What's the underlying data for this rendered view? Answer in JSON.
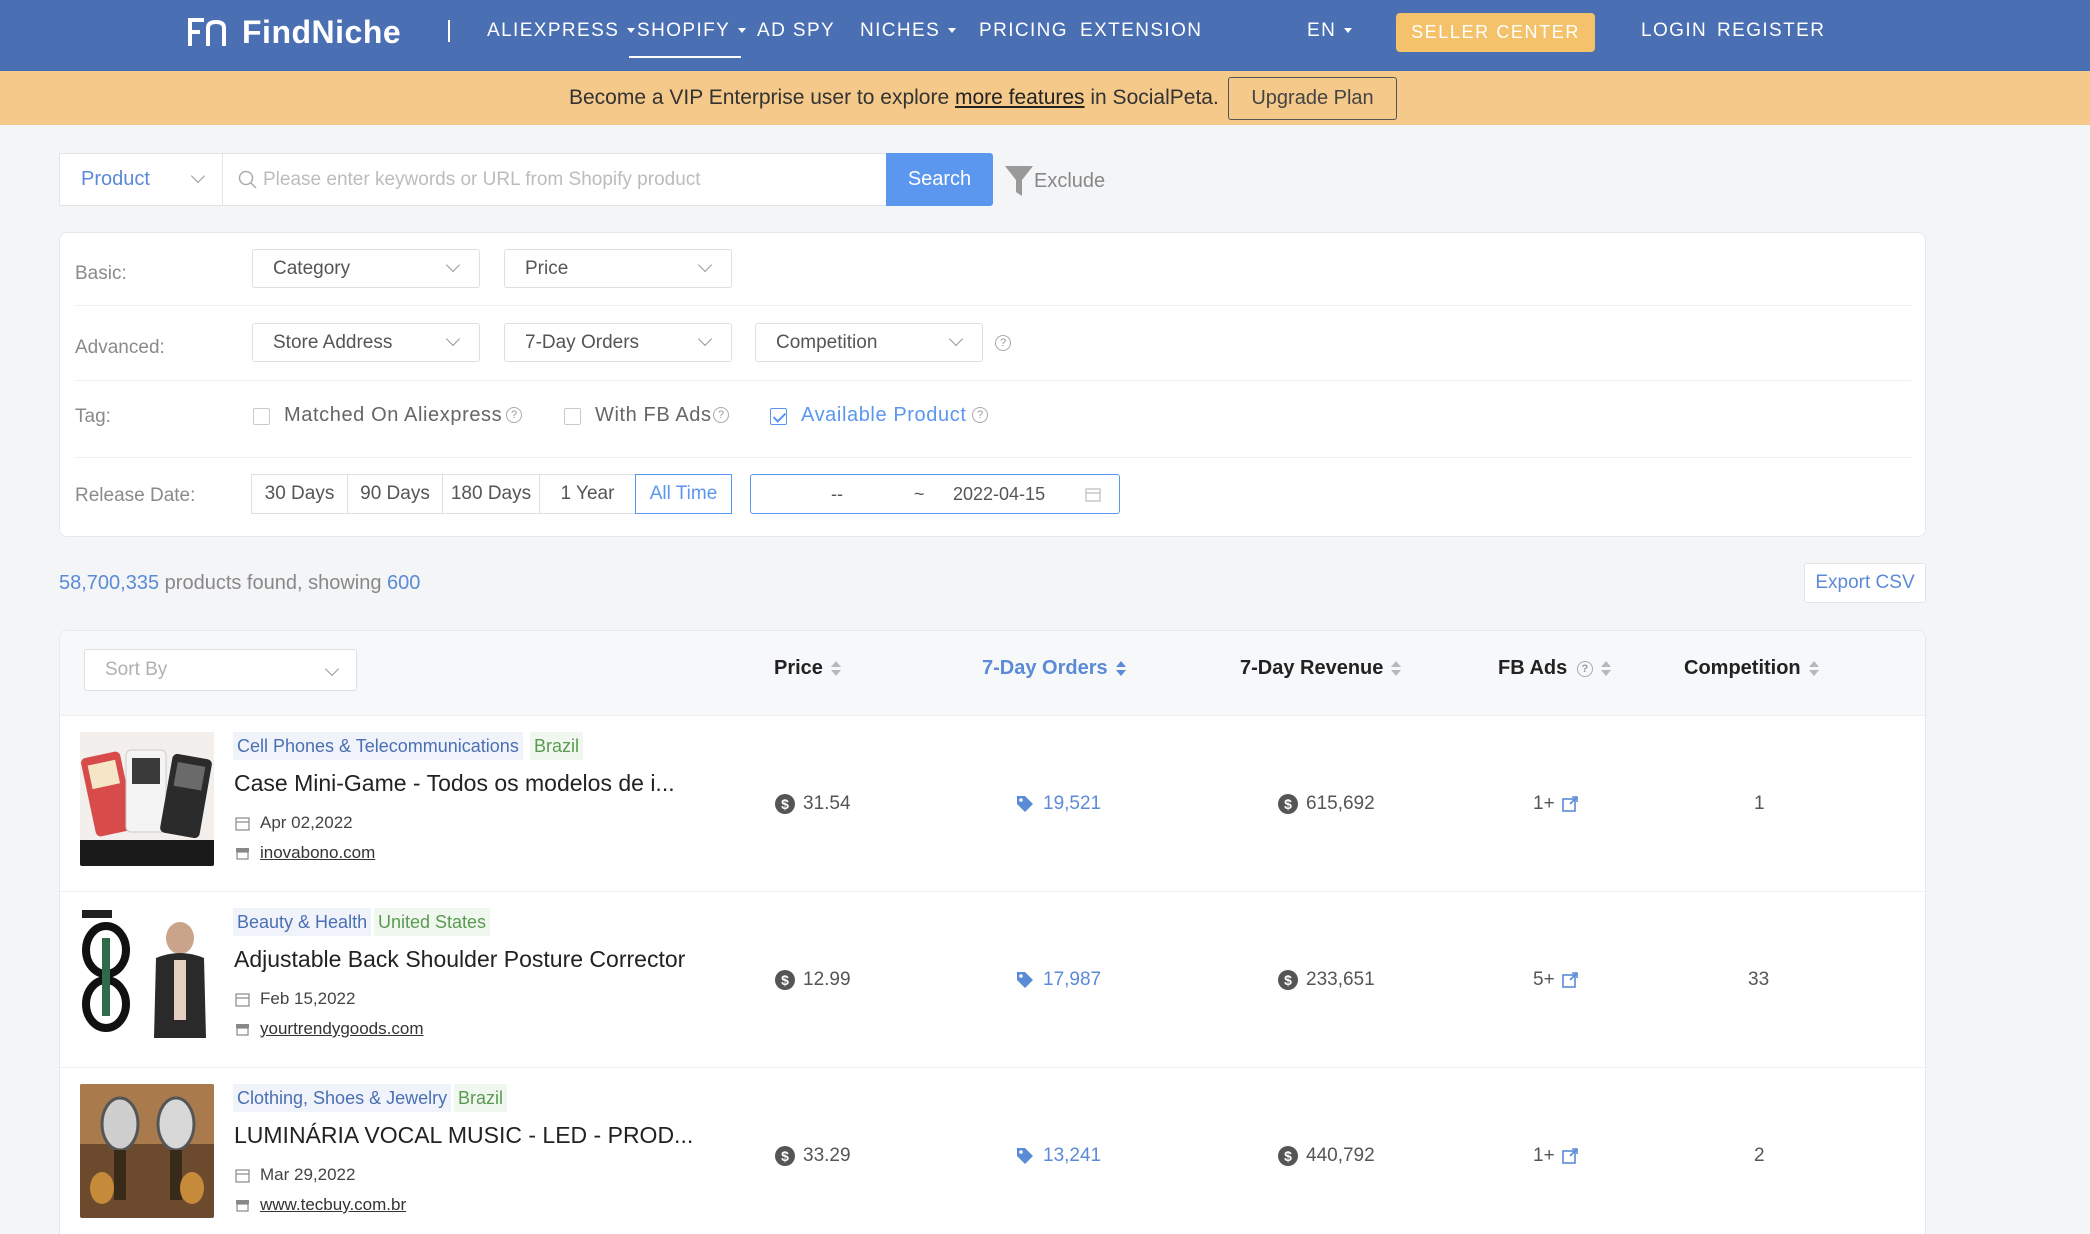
{
  "brand": {
    "name": "FindNiche"
  },
  "nav": {
    "items": [
      {
        "label": "ALIEXPRESS",
        "caret": true
      },
      {
        "label": "SHOPIFY",
        "caret": true,
        "active": true
      },
      {
        "label": "AD SPY",
        "caret": false
      },
      {
        "label": "NICHES",
        "caret": true
      },
      {
        "label": "PRICING",
        "caret": false
      },
      {
        "label": "EXTENSION",
        "caret": false
      }
    ],
    "language": "EN",
    "seller_center": "SELLER CENTER",
    "login": "LOGIN",
    "register": "REGISTER"
  },
  "banner": {
    "text_before": "Become a VIP Enterprise user to explore ",
    "link": "more features",
    "text_after": " in SocialPeta.",
    "button": "Upgrade Plan"
  },
  "search": {
    "type": "Product",
    "placeholder": "Please enter keywords or URL from Shopify product",
    "value": "",
    "button": "Search",
    "exclude": "Exclude"
  },
  "filters": {
    "basic_label": "Basic:",
    "basic": [
      "Category",
      "Price"
    ],
    "advanced_label": "Advanced:",
    "advanced": [
      "Store Address",
      "7-Day Orders",
      "Competition"
    ],
    "tag_label": "Tag:",
    "tags": [
      {
        "label": "Matched On Aliexpress",
        "checked": false
      },
      {
        "label": "With FB Ads",
        "checked": false
      },
      {
        "label": "Available Product",
        "checked": true
      }
    ],
    "release_label": "Release Date:",
    "release_options": [
      "30 Days",
      "90 Days",
      "180 Days",
      "1 Year",
      "All Time"
    ],
    "release_active": "All Time",
    "date_from": "--",
    "date_sep": "~",
    "date_to": "2022-04-15"
  },
  "results": {
    "count": "58,700,335",
    "mid_text": " products found, showing ",
    "showing": "600",
    "export": "Export CSV"
  },
  "table": {
    "sort_placeholder": "Sort By",
    "columns": [
      "Price",
      "7-Day Orders",
      "7-Day Revenue",
      "FB Ads",
      "Competition"
    ],
    "active_column": "7-Day Orders",
    "rows": [
      {
        "category": "Cell Phones & Telecommunications",
        "country": "Brazil",
        "title": "Case Mini-Game - Todos os modelos de i...",
        "date": "Apr 02,2022",
        "store": "inovabono.com",
        "price": "31.54",
        "orders": "19,521",
        "revenue": "615,692",
        "fb_ads": "1+",
        "competition": "1"
      },
      {
        "category": "Beauty & Health",
        "country": "United States",
        "title": "Adjustable Back Shoulder Posture Corrector",
        "date": "Feb 15,2022",
        "store": "yourtrendygoods.com",
        "price": "12.99",
        "orders": "17,987",
        "revenue": "233,651",
        "fb_ads": "5+",
        "competition": "33"
      },
      {
        "category": "Clothing, Shoes & Jewelry",
        "country": "Brazil",
        "title": "LUMINÁRIA VOCAL MUSIC - LED - PROD...",
        "date": "Mar 29,2022",
        "store": "www.tecbuy.com.br",
        "price": "33.29",
        "orders": "13,241",
        "revenue": "440,792",
        "fb_ads": "1+",
        "competition": "2"
      }
    ]
  },
  "colors": {
    "nav_bg": "#4a6fb3",
    "banner_bg": "#f4c98a",
    "accent": "#5b96ef",
    "seller_btn": "#f4c26b"
  }
}
